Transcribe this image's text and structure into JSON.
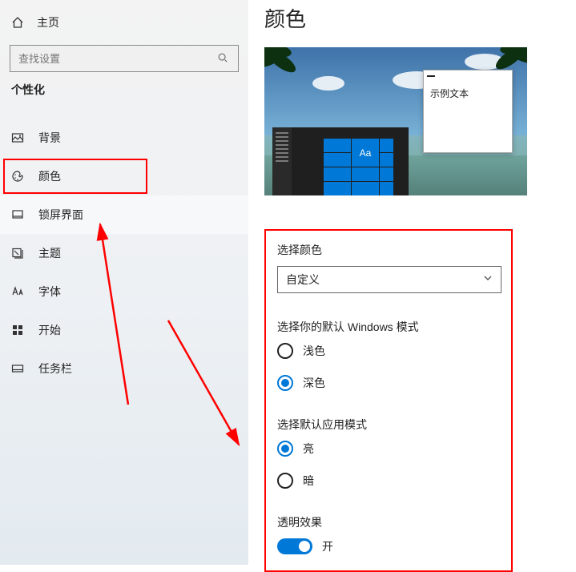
{
  "sidebar": {
    "home": "主页",
    "search_placeholder": "查找设置",
    "section": "个性化",
    "items": [
      {
        "label": "背景"
      },
      {
        "label": "颜色"
      },
      {
        "label": "锁屏界面"
      },
      {
        "label": "主题"
      },
      {
        "label": "字体"
      },
      {
        "label": "开始"
      },
      {
        "label": "任务栏"
      }
    ]
  },
  "page": {
    "title": "颜色",
    "preview": {
      "sample_text": "示例文本",
      "tile_label": "Aa"
    },
    "color_select": {
      "label": "选择颜色",
      "value": "自定义"
    },
    "windows_mode": {
      "label": "选择你的默认 Windows 模式",
      "options": {
        "light": "浅色",
        "dark": "深色"
      },
      "selected": "dark"
    },
    "app_mode": {
      "label": "选择默认应用模式",
      "options": {
        "light": "亮",
        "dark": "暗"
      },
      "selected": "light"
    },
    "transparency": {
      "label": "透明效果",
      "state_label": "开"
    }
  }
}
